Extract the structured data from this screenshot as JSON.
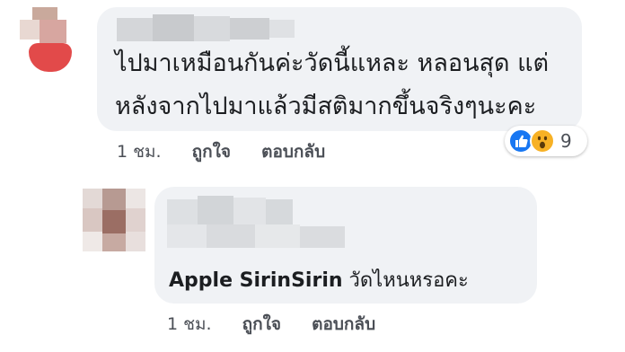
{
  "comment1": {
    "line1": "ไปมาเหมือนกันค่ะวัดนี้แหละ หลอนสุด แต่",
    "line2": "หลังจากไปมาแล้วมีสติมากขึ้นจริงๆนะคะ",
    "time": "1 ชม.",
    "like_label": "ถูกใจ",
    "reply_label": "ตอบกลับ",
    "reactions": {
      "icons": [
        "like-icon",
        "wow-icon"
      ],
      "count": "9"
    }
  },
  "comment2": {
    "tag_name": "Apple SirinSirin",
    "text": "วัดไหนหรอคะ",
    "time": "1 ชม.",
    "like_label": "ถูกใจ",
    "reply_label": "ตอบกลับ"
  },
  "colors": {
    "bubble": "#f0f2f5",
    "like": "#1877f2",
    "wow": "#f7b125",
    "meta": "#4b4f56"
  }
}
